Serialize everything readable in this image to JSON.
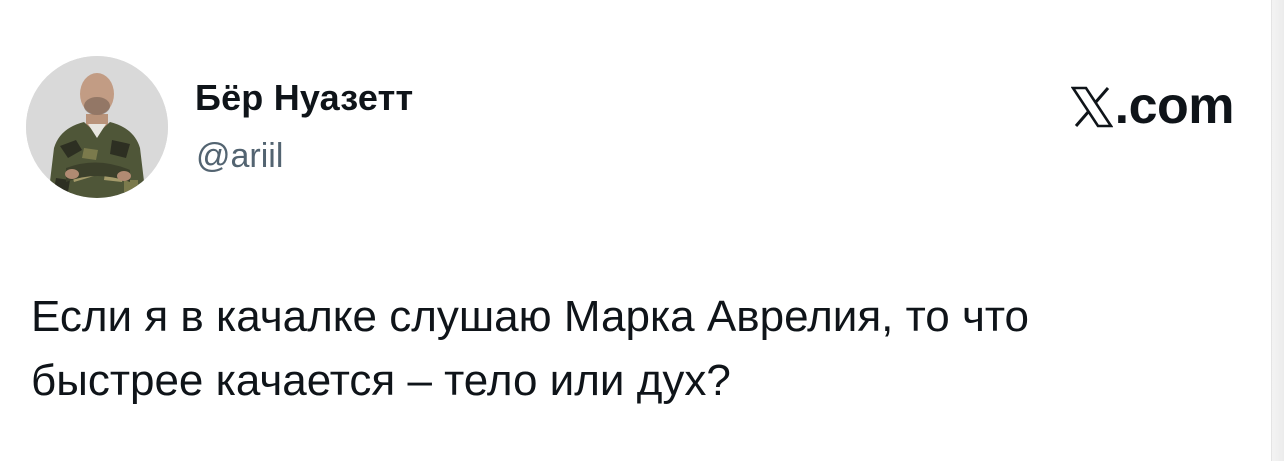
{
  "post": {
    "author_name": "Бёр Нуазетт",
    "author_handle": "@ariil",
    "brand_label": ".com",
    "brand_icon": "x-logo-icon",
    "text_line_1": "Если я в качалке слушаю Марка Аврелия, то что",
    "text_line_2": "быстрее качается – тело или дух?"
  },
  "colors": {
    "text": "#0f1419",
    "secondary_text": "#536471",
    "background": "#ffffff"
  }
}
